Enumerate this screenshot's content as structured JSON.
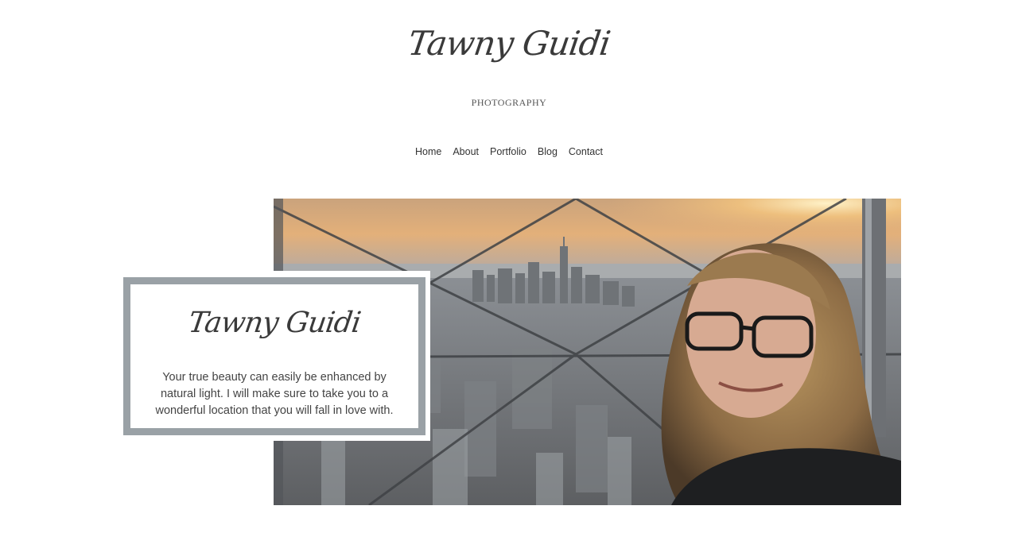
{
  "header": {
    "site_title": "Tawny Guidi",
    "tagline": "PHOTOGRAPHY"
  },
  "nav": {
    "items": [
      {
        "label": "Home"
      },
      {
        "label": "About"
      },
      {
        "label": "Portfolio"
      },
      {
        "label": "Blog"
      },
      {
        "label": "Contact"
      }
    ]
  },
  "hero": {
    "card_title": "Tawny Guidi",
    "card_text": "Your true beauty can easily be enhanced by natural light. I will make sure to take you to a wonderful location that you will fall in love with.",
    "frame_color": "#9aa1a6"
  }
}
